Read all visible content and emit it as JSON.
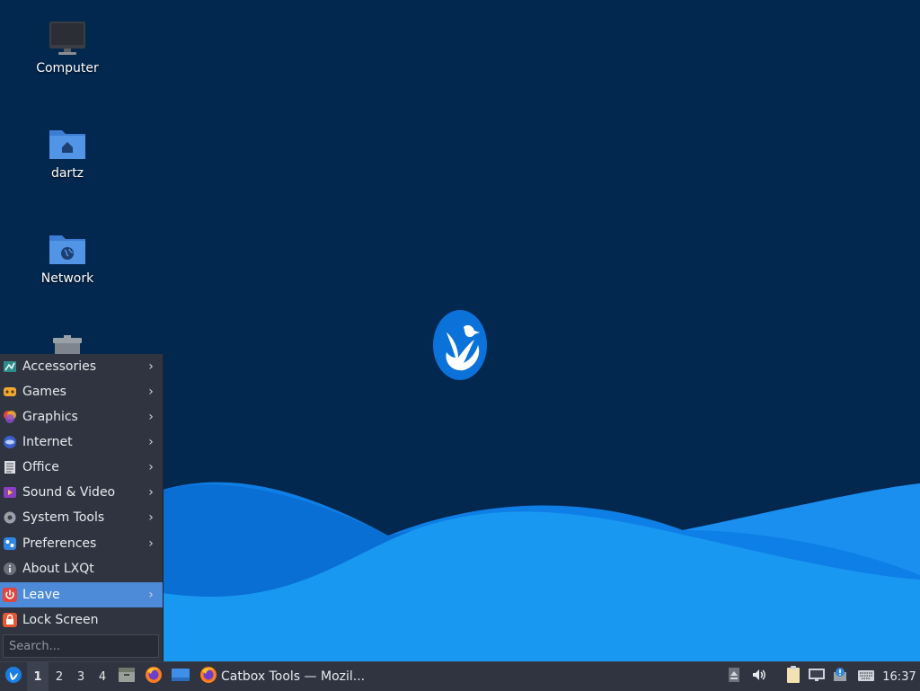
{
  "desktop": {
    "icons": [
      {
        "label": "Computer",
        "icon": "computer-icon"
      },
      {
        "label": "dartz",
        "icon": "home-folder-icon"
      },
      {
        "label": "Network",
        "icon": "network-folder-icon"
      },
      {
        "label": "",
        "icon": "trash-icon"
      }
    ],
    "wallpaper_logo": "lubuntu-logo",
    "colors": {
      "background": "#03284f",
      "wave_light": "#1a96f0",
      "wave_dark": "#0b6fd6"
    }
  },
  "start_menu": {
    "items": [
      {
        "label": "Accessories",
        "icon": "accessories-icon",
        "submenu": true
      },
      {
        "label": "Games",
        "icon": "games-icon",
        "submenu": true
      },
      {
        "label": "Graphics",
        "icon": "graphics-icon",
        "submenu": true
      },
      {
        "label": "Internet",
        "icon": "internet-icon",
        "submenu": true
      },
      {
        "label": "Office",
        "icon": "office-icon",
        "submenu": true
      },
      {
        "label": "Sound & Video",
        "icon": "sound-video-icon",
        "submenu": true
      },
      {
        "label": "System Tools",
        "icon": "system-tools-icon",
        "submenu": true
      },
      {
        "label": "Preferences",
        "icon": "preferences-icon",
        "submenu": true
      },
      {
        "label": "About LXQt",
        "icon": "info-icon",
        "submenu": false
      },
      {
        "label": "Leave",
        "icon": "power-icon",
        "submenu": true,
        "highlighted": true
      },
      {
        "label": "Lock Screen",
        "icon": "lock-icon",
        "submenu": false
      }
    ],
    "search_placeholder": "Search...",
    "highlight_color": "#4d8ad8"
  },
  "taskbar": {
    "start_button_icon": "lubuntu-start-icon",
    "desktops": [
      "1",
      "2",
      "3",
      "4"
    ],
    "current_desktop": "1",
    "quicklaunch": [
      "file-manager-icon",
      "firefox-icon",
      "show-desktop-icon"
    ],
    "task": {
      "title": "Catbox Tools — Mozil...",
      "icon": "firefox-icon"
    },
    "tray_icons": [
      "eject-icon",
      "volume-icon",
      "clipboard-icon",
      "network-wired-icon",
      "update-notifier-icon",
      "keyboard-icon"
    ],
    "clock": "16:37"
  }
}
